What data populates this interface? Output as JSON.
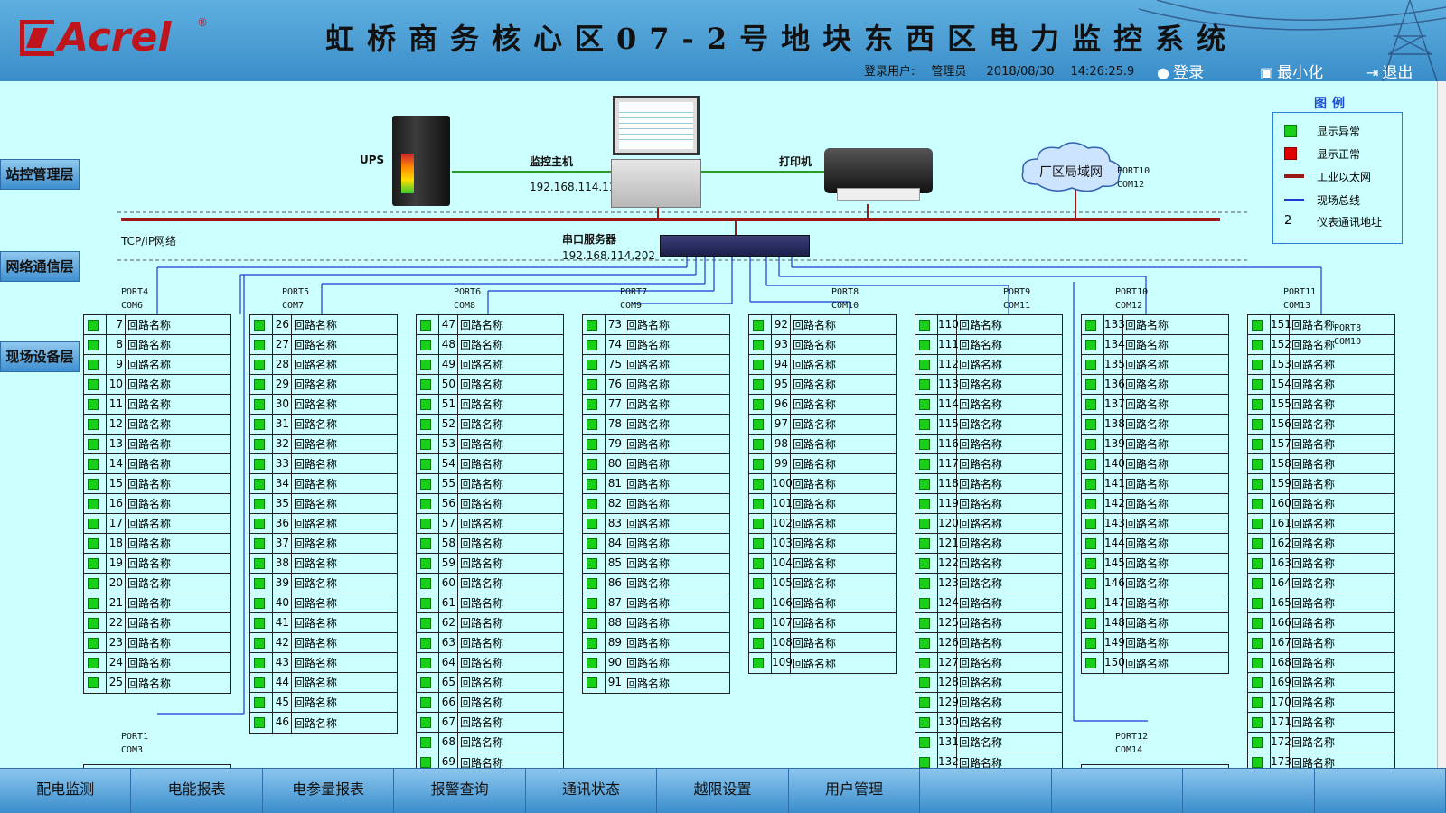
{
  "header": {
    "logo_text": "Acrel",
    "logo_reg": "®",
    "title": "虹桥商务核心区07-2号地块东西区电力监控系统",
    "user_label": "登录用户:",
    "user_name": "管理员",
    "date": "2018/08/30",
    "time": "14:26:25.9",
    "login_label": "登录",
    "minimize_label": "最小化",
    "exit_label": "退出"
  },
  "layers": {
    "station": "站控管理层",
    "network": "网络通信层",
    "field": "现场设备层"
  },
  "devices": {
    "ups_label": "UPS",
    "host_label": "监控主机",
    "host_ip": "192.168.114.11",
    "printer_label": "打印机",
    "lan_label": "厂区局域网",
    "lan_port": "PORT10",
    "lan_com": "COM12",
    "tcp_label": "TCP/IP网络",
    "serial_label": "串口服务器",
    "serial_ip": "192.168.114.202"
  },
  "legend": {
    "title": "图例",
    "items": [
      {
        "type": "green-box",
        "label": "显示异常"
      },
      {
        "type": "red-box",
        "label": "显示正常"
      },
      {
        "type": "ethernet-line",
        "label": "工业以太网"
      },
      {
        "type": "bus-line",
        "label": "现场总线"
      },
      {
        "type": "address",
        "key": "2",
        "label": "仪表通讯地址"
      }
    ]
  },
  "colors": {
    "normal": "#18d018",
    "abnormal": "#e00000",
    "ethernet": "#9b1818",
    "bus": "#1a3ad0",
    "background": "#ccffff"
  },
  "circuit_name": "回路名称",
  "panels": [
    {
      "port": "PORT4",
      "com": "COM6",
      "start": 7,
      "end": 25
    },
    {
      "port": "PORT5",
      "com": "COM7",
      "start": 26,
      "end": 46
    },
    {
      "port": "PORT6",
      "com": "COM8",
      "start": 47,
      "end": 69
    },
    {
      "port": "PORT7",
      "com": "COM9",
      "start": 73,
      "end": 91
    },
    {
      "port": "PORT8",
      "com": "COM10",
      "start": 92,
      "end": 109
    },
    {
      "port": "PORT9",
      "com": "COM11",
      "start": 110,
      "end": 132
    },
    {
      "port": "PORT10",
      "com": "COM12",
      "start": 133,
      "end": 150
    },
    {
      "port": "PORT11",
      "com": "COM13",
      "start": 151,
      "end": 173
    }
  ],
  "extra_ports": [
    {
      "port": "PORT1",
      "com": "COM3"
    },
    {
      "port": "PORT12",
      "com": "COM14"
    },
    {
      "port": "PORT8",
      "com": "COM10"
    }
  ],
  "footer_nav": [
    "配电监测",
    "电能报表",
    "电参量报表",
    "报警查询",
    "通讯状态",
    "越限设置",
    "用户管理",
    "",
    "",
    "",
    ""
  ]
}
